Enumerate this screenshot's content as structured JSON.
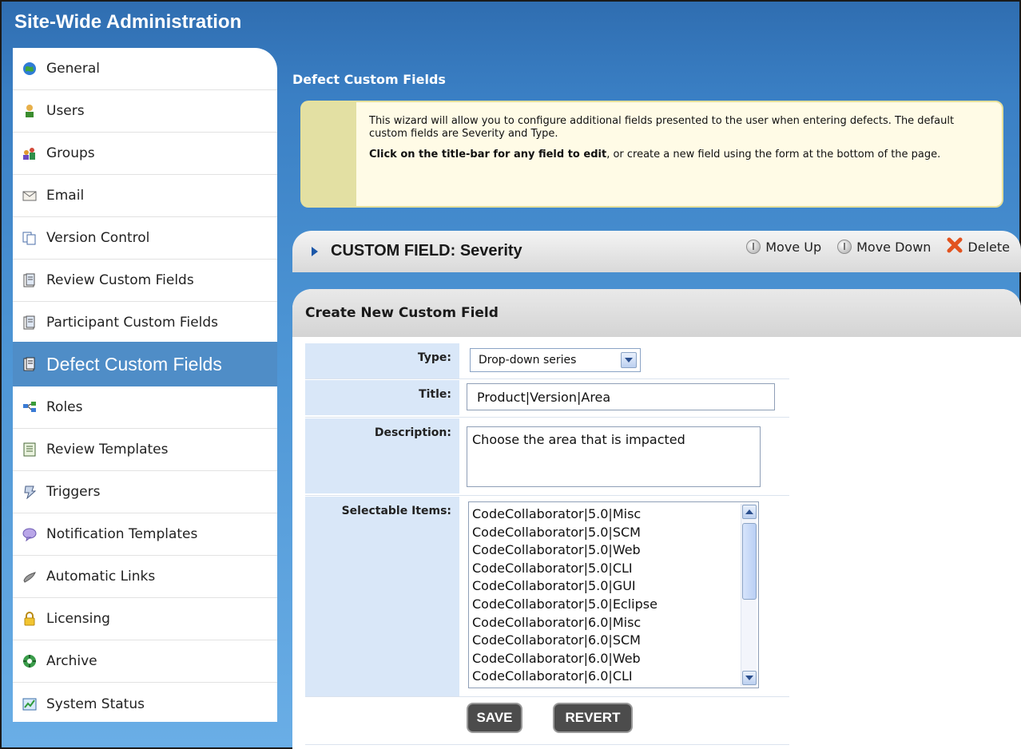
{
  "app": {
    "title": "Site-Wide Administration"
  },
  "sidebar": {
    "items": [
      {
        "label": "General",
        "icon": "globe-icon"
      },
      {
        "label": "Users",
        "icon": "user-icon"
      },
      {
        "label": "Groups",
        "icon": "groups-icon"
      },
      {
        "label": "Email",
        "icon": "envelope-icon"
      },
      {
        "label": "Version Control",
        "icon": "copy-icon"
      },
      {
        "label": "Review Custom Fields",
        "icon": "form-icon"
      },
      {
        "label": "Participant Custom Fields",
        "icon": "form-icon"
      },
      {
        "label": "Defect Custom Fields",
        "icon": "form-icon",
        "active": true
      },
      {
        "label": "Roles",
        "icon": "roles-icon"
      },
      {
        "label": "Review Templates",
        "icon": "template-icon"
      },
      {
        "label": "Triggers",
        "icon": "trigger-icon"
      },
      {
        "label": "Notification Templates",
        "icon": "chat-bubble-icon"
      },
      {
        "label": "Automatic Links",
        "icon": "link-icon"
      },
      {
        "label": "Licensing",
        "icon": "lock-icon"
      },
      {
        "label": "Archive",
        "icon": "archive-icon"
      },
      {
        "label": "System Status",
        "icon": "chart-icon"
      }
    ]
  },
  "main": {
    "heading": "Defect Custom Fields",
    "info": {
      "line1": "This wizard will allow you to configure additional fields presented to the user when entering defects. The default custom fields are Severity and Type.",
      "bold": "Click on the title-bar for any field to edit",
      "line2_rest": ", or create a new field using the form at the bottom of the page."
    },
    "custom_field": {
      "title": "CUSTOM FIELD:  Severity",
      "move_up": "Move Up",
      "move_down": "Move Down",
      "delete": "Delete"
    },
    "create": {
      "title": "Create New Custom Field",
      "type_label": "Type:",
      "type_value": "Drop-down series",
      "title_label": "Title:",
      "title_value": "Product|Version|Area",
      "description_label": "Description:",
      "description_value": "Choose the area that is impacted",
      "items_label": "Selectable Items:",
      "items": [
        "CodeCollaborator|5.0|Misc",
        "CodeCollaborator|5.0|SCM",
        "CodeCollaborator|5.0|Web",
        "CodeCollaborator|5.0|CLI",
        "CodeCollaborator|5.0|GUI",
        "CodeCollaborator|5.0|Eclipse",
        "CodeCollaborator|6.0|Misc",
        "CodeCollaborator|6.0|SCM",
        "CodeCollaborator|6.0|Web",
        "CodeCollaborator|6.0|CLI"
      ],
      "save_label": "SAVE",
      "revert_label": "REVERT"
    }
  },
  "colors": {
    "accent": "#4f8dc7",
    "info_bg": "#fffbe6",
    "label_bg": "#d9e7f8"
  }
}
